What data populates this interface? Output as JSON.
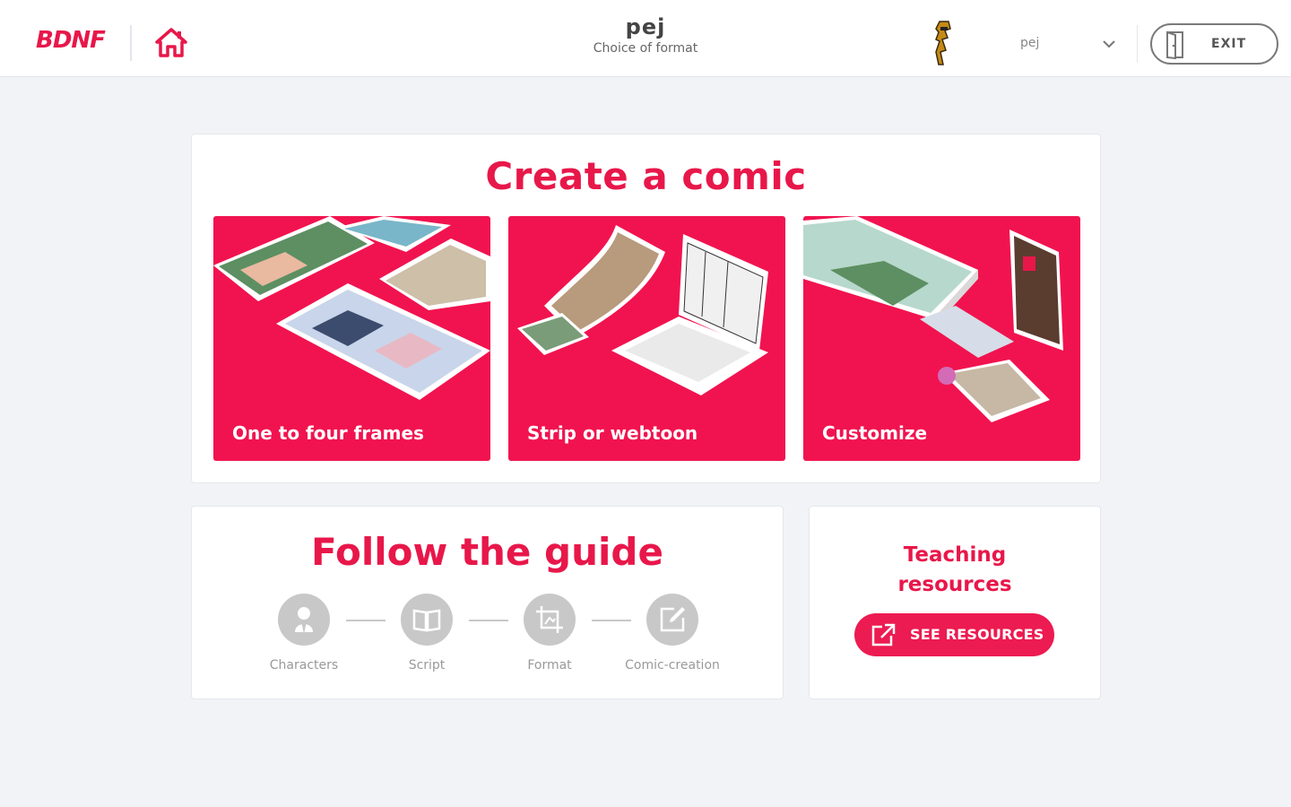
{
  "header": {
    "logo_text": "BDNF",
    "title": "pej",
    "subtitle": "Choice of format",
    "user_name": "pej",
    "exit_label": "EXIT"
  },
  "create": {
    "heading": "Create a comic",
    "cards": [
      {
        "label": "One to four frames"
      },
      {
        "label": "Strip or webtoon"
      },
      {
        "label": "Customize"
      }
    ]
  },
  "guide": {
    "heading": "Follow the guide",
    "steps": [
      {
        "label": "Characters",
        "icon": "characters-icon"
      },
      {
        "label": "Script",
        "icon": "book-icon"
      },
      {
        "label": "Format",
        "icon": "crop-icon"
      },
      {
        "label": "Comic-creation",
        "icon": "edit-icon"
      }
    ]
  },
  "teaching": {
    "heading_line1": "Teaching",
    "heading_line2": "resources",
    "button_label": "SEE RESOURCES"
  },
  "colors": {
    "accent": "#e8174a",
    "card_bg": "#f1134f",
    "step_gray": "#c8c8c8",
    "page_bg": "#f2f3f7"
  }
}
